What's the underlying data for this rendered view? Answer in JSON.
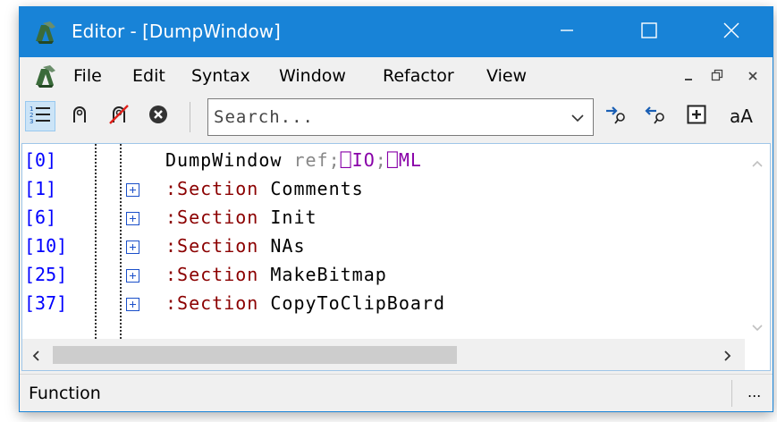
{
  "window": {
    "title": "Editor - [DumpWindow]",
    "accent_color": "#1883d7",
    "icons": {
      "app": "apl-app-icon",
      "minimize": "minimize-icon",
      "maximize": "maximize-icon",
      "close": "close-icon"
    }
  },
  "menubar": {
    "items": [
      "File",
      "Edit",
      "Syntax",
      "Window",
      "Refactor",
      "View"
    ],
    "mdi_controls": [
      "minimize",
      "restore",
      "close"
    ]
  },
  "toolbar": {
    "buttons": [
      "line-numbers-toggle",
      "stop-toggle",
      "clear-stops",
      "close-all"
    ],
    "search": {
      "placeholder": "Search...",
      "value": ""
    },
    "right_buttons": [
      "search-next",
      "search-prev",
      "toggle-expand",
      "case-sensitive"
    ],
    "case_label": "aA"
  },
  "editor": {
    "line_numbers": [
      "[0]",
      "[1]",
      "[6]",
      "[10]",
      "[25]",
      "[37]"
    ],
    "header": {
      "name": "DumpWindow",
      "args": "ref;",
      "sys1": "⎕IO",
      "sep": ";",
      "sys2": "⎕ML"
    },
    "sections": [
      {
        "keyword": ":Section",
        "name": "Comments"
      },
      {
        "keyword": ":Section",
        "name": "Init"
      },
      {
        "keyword": ":Section",
        "name": "NAs"
      },
      {
        "keyword": ":Section",
        "name": "MakeBitmap"
      },
      {
        "keyword": ":Section",
        "name": "CopyToClipBoard"
      }
    ]
  },
  "statusbar": {
    "text": "Function",
    "ellipsis": "..."
  }
}
